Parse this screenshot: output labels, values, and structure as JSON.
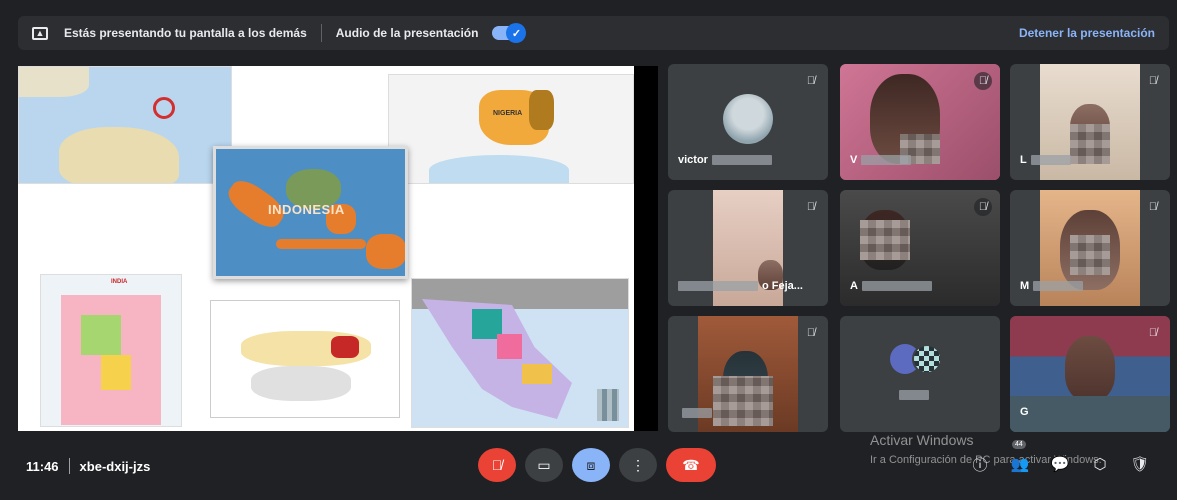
{
  "banner": {
    "presenting_text": "Estás presentando tu pantalla a los demás",
    "audio_label": "Audio de la presentación",
    "audio_enabled": true,
    "stop_label": "Detener la presentación"
  },
  "presentation": {
    "maps": [
      {
        "name": "australia-map"
      },
      {
        "name": "nigeria-map",
        "label": "NIGERIA"
      },
      {
        "name": "indonesia-map",
        "label": "INDONESIA"
      },
      {
        "name": "india-map",
        "label": "INDIA"
      },
      {
        "name": "world-map"
      },
      {
        "name": "mexico-map"
      }
    ]
  },
  "participants": [
    {
      "name": "victor",
      "muted": true
    },
    {
      "name": "V",
      "muted": true
    },
    {
      "name": "L",
      "muted": true
    },
    {
      "name": "o Feja...",
      "muted": true
    },
    {
      "name": "A",
      "muted": true
    },
    {
      "name": "M",
      "muted": true
    },
    {
      "name": "",
      "muted": true
    },
    {
      "name": "",
      "muted": false
    },
    {
      "name": "G",
      "muted": true
    }
  ],
  "meeting": {
    "time": "11:46",
    "code": "xbe-dxij-jzs"
  },
  "people_count": "44",
  "watermark": {
    "title": "Activar Windows",
    "subtitle": "Ir a Configuración de PC para activar Windows."
  },
  "colors": {
    "background": "#202124",
    "accent": "#8ab4f8",
    "danger": "#ea4335"
  },
  "icons": {
    "present": "present-screen-icon",
    "mic_off": "mic-off-icon",
    "camera": "camera-icon",
    "present_now": "present-now-icon",
    "more": "more-options-icon",
    "end_call": "end-call-icon",
    "info": "info-icon",
    "people": "people-icon",
    "chat": "chat-icon",
    "activities": "activities-icon",
    "host": "host-controls-icon"
  }
}
